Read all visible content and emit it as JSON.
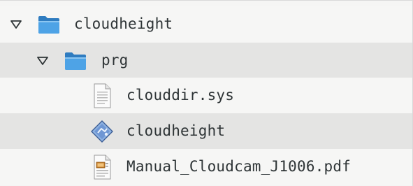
{
  "tree": {
    "items": [
      {
        "label": "cloudheight",
        "icon": "folder-icon",
        "expanded": true,
        "level": 0
      },
      {
        "label": "prg",
        "icon": "folder-icon",
        "expanded": true,
        "level": 1
      },
      {
        "label": "clouddir.sys",
        "icon": "text-file-icon",
        "level": 2
      },
      {
        "label": "cloudheight",
        "icon": "executable-file-icon",
        "level": 2
      },
      {
        "label": "Manual_Cloudcam_J1006.pdf",
        "icon": "pdf-file-icon",
        "level": 2
      }
    ]
  },
  "colors": {
    "row_light": "#f6f6f5",
    "row_dark": "#e4e4e3",
    "folder_blue": "#3f8fd2",
    "text": "#2e3436"
  }
}
